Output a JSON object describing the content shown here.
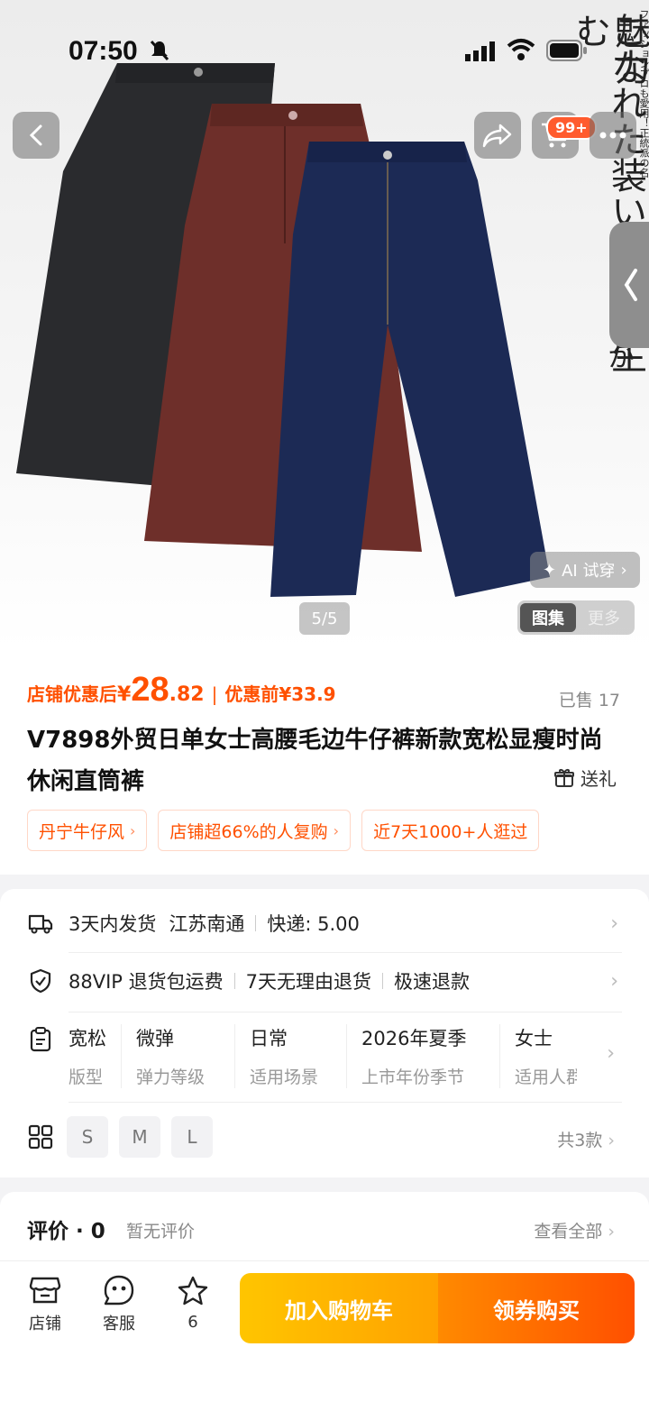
{
  "status_bar": {
    "time": "07:50"
  },
  "header": {
    "cart_badge": "99+"
  },
  "hero": {
    "jp_main": "「トラッドコート」の魅力",
    "jp_main2": "こなれた装いに差を生む",
    "jp_tail": "か",
    "jp_small": "ファッションプロも愛用！正統派の名",
    "ai_try": "AI 试穿",
    "page_indicator": "5/5",
    "gallery_tab": "图集",
    "more_tab": "更多"
  },
  "price": {
    "label": "店铺优惠后",
    "yen": "¥",
    "integer": "28",
    "decimal": ".82",
    "separator": "|",
    "original_label": "优惠前¥33.9",
    "sold": "已售 17"
  },
  "product": {
    "title": "V7898外贸日单女士高腰毛边牛仔裤新款宽松显瘦时尚休闲直筒裤",
    "gift": "送礼"
  },
  "tags": [
    {
      "label": "丹宁牛仔风"
    },
    {
      "label": "店铺超66%的人复购"
    },
    {
      "label": "近7天1000+人逛过"
    }
  ],
  "service": {
    "shipping": {
      "days": "3天内发货",
      "origin": "江苏南通",
      "express": "快递: 5.00"
    },
    "returns": {
      "a": "88VIP 退货包运费",
      "b": "7天无理由退货",
      "c": "极速退款"
    },
    "attributes": [
      {
        "value": "宽松",
        "key": "版型"
      },
      {
        "value": "微弹",
        "key": "弹力等级"
      },
      {
        "value": "日常",
        "key": "适用场景"
      },
      {
        "value": "2026年夏季",
        "key": "上市年份季节"
      },
      {
        "value": "女士",
        "key": "适用人群"
      }
    ],
    "sizes": [
      "S",
      "M",
      "L"
    ],
    "count": "共3款"
  },
  "review": {
    "title": "评价 · 0",
    "subtitle": "暂无评价",
    "view_all": "查看全部"
  },
  "bottom_bar": {
    "store": "店铺",
    "service": "客服",
    "favorite_count": "6",
    "add_to_cart": "加入购物车",
    "buy": "领券购买"
  },
  "colors": {
    "accent": "#ff5000",
    "cart_yellow": "#ffb300"
  }
}
